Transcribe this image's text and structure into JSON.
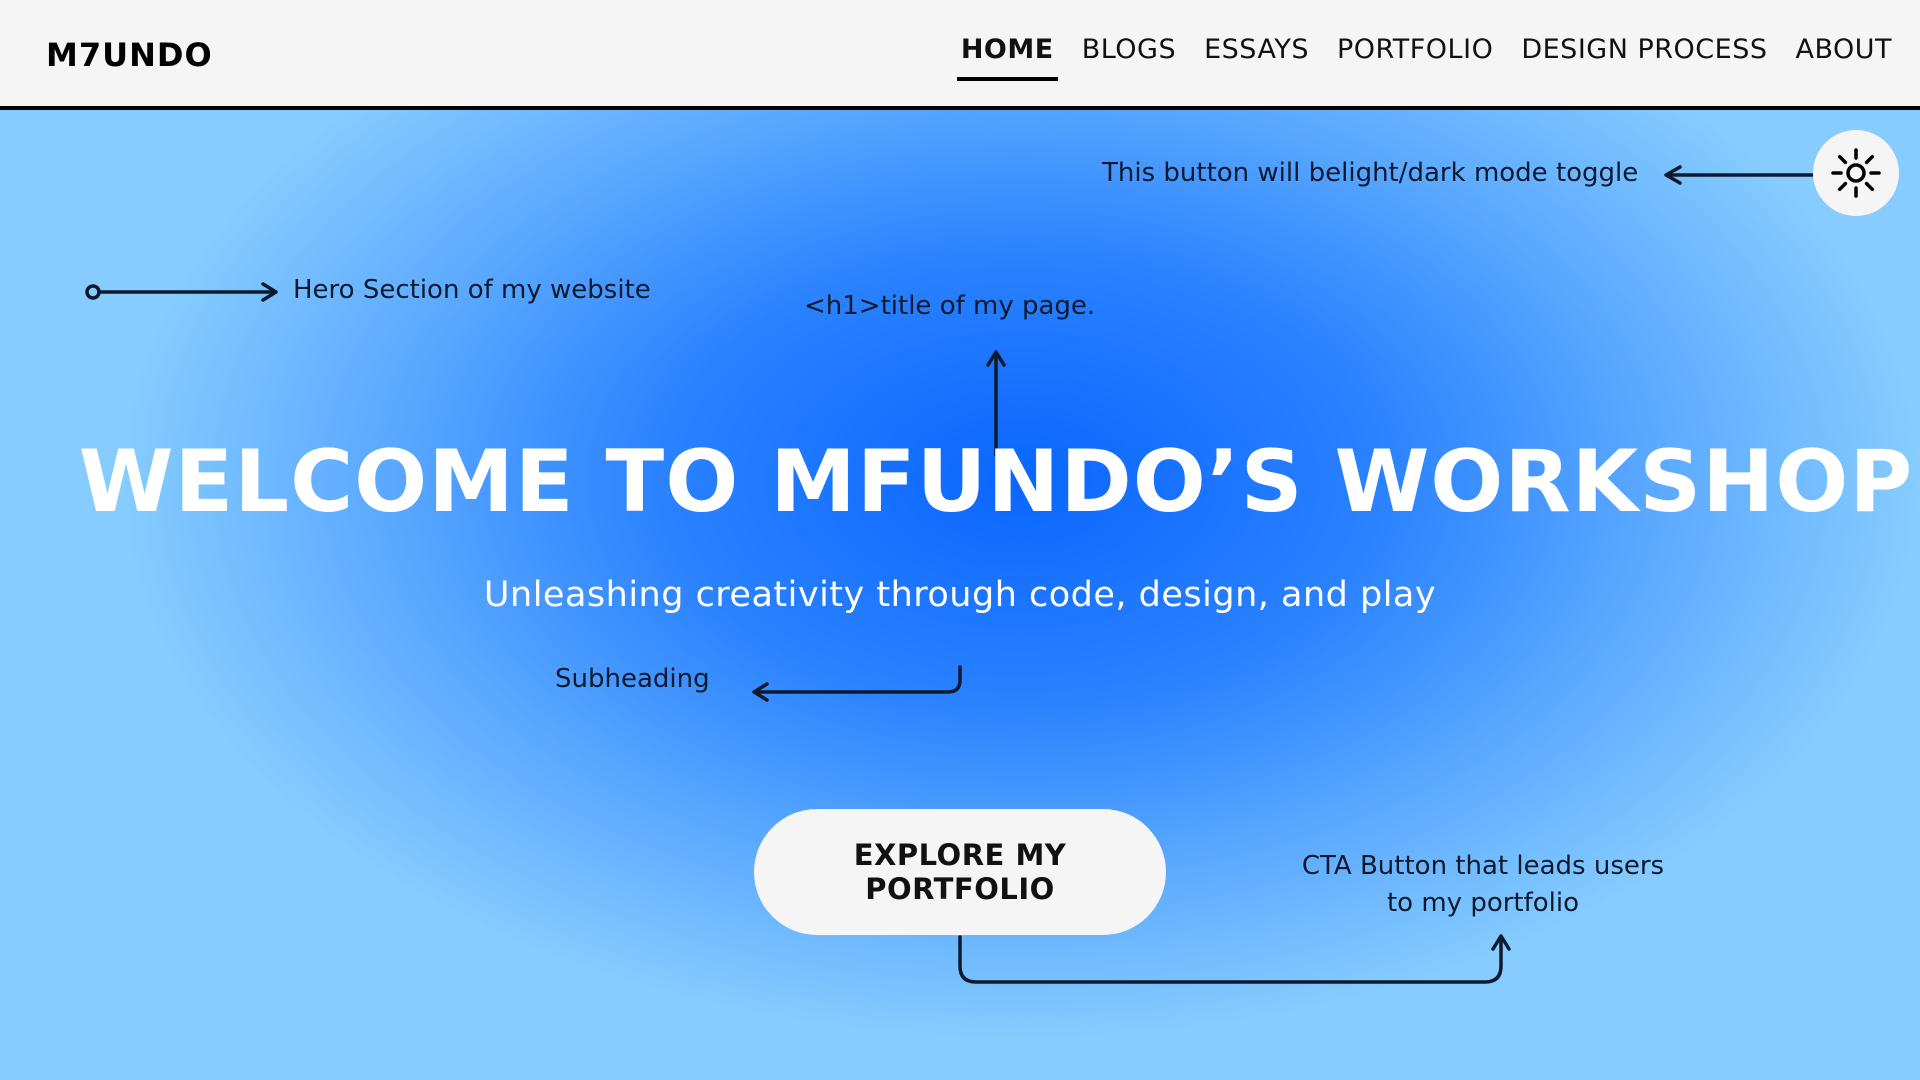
{
  "nav": {
    "logo": "M7UNDO",
    "items": [
      {
        "label": "HOME",
        "active": true
      },
      {
        "label": "BLOGS",
        "active": false
      },
      {
        "label": "ESSAYS",
        "active": false
      },
      {
        "label": "PORTFOLIO",
        "active": false
      },
      {
        "label": "DESIGN PROCESS",
        "active": false
      },
      {
        "label": "ABOUT",
        "active": false
      }
    ]
  },
  "hero": {
    "title": "WELCOME TO MFUNDO’S WORKSHOP",
    "subtitle": "Unleashing creativity through code, design, and play",
    "cta_label": "EXPLORE MY PORTFOLIO",
    "toggle_icon": "sun-icon"
  },
  "annotations": {
    "toggle_note": "This button will belight/dark mode toggle",
    "hero_note": "Hero Section of my website",
    "title_note": "<h1>title of my page.",
    "subheading_note": "Subheading",
    "cta_note_line1": "CTA Button that leads users",
    "cta_note_line2": "to my portfolio"
  },
  "colors": {
    "gradient_center": "#0a66ff",
    "gradient_edge": "#86ccff",
    "nav_bg": "#f5f5f5",
    "button_bg": "#f5f5f5",
    "annotation_ink": "#0d1a2e"
  }
}
